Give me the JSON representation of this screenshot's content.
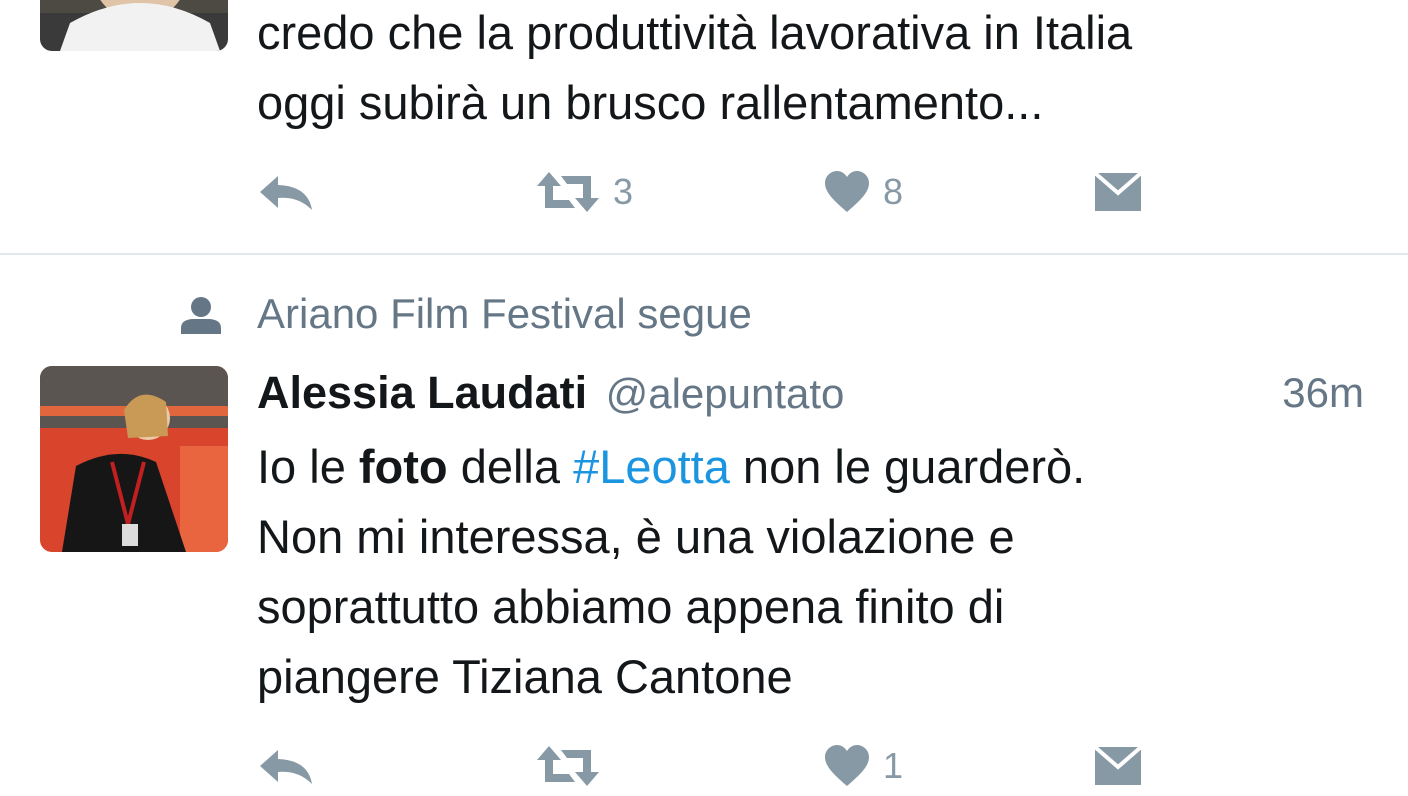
{
  "colors": {
    "icon_gray": "#8899a6",
    "secondary_text": "#657786",
    "hashtag_blue": "#1b95e0",
    "divider": "#e1e8ed"
  },
  "tweet1": {
    "text_lines": [
      "credo che la produttività lavorativa in Italia",
      "oggi subirà un brusco rallentamento..."
    ],
    "actions": {
      "reply_icon": "reply-icon",
      "retweet_icon": "retweet-icon",
      "retweet_count": "3",
      "like_icon": "heart-icon",
      "like_count": "8",
      "dm_icon": "envelope-icon"
    }
  },
  "context": {
    "icon": "person-icon",
    "text": "Ariano Film Festival segue"
  },
  "tweet2": {
    "display_name": "Alessia Laudati",
    "handle": "@alepuntato",
    "timestamp": "36m",
    "line1": {
      "part1": "Io le ",
      "bold": "foto",
      "part2": " della ",
      "hashtag": "#Leotta",
      "part3": " non le guarderò."
    },
    "line2": "Non mi interessa, è una violazione e",
    "line3": "soprattutto abbiamo appena finito di",
    "line4": "piangere Tiziana Cantone",
    "actions": {
      "reply_icon": "reply-icon",
      "retweet_icon": "retweet-icon",
      "like_icon": "heart-icon",
      "like_count": "1",
      "dm_icon": "envelope-icon"
    }
  }
}
